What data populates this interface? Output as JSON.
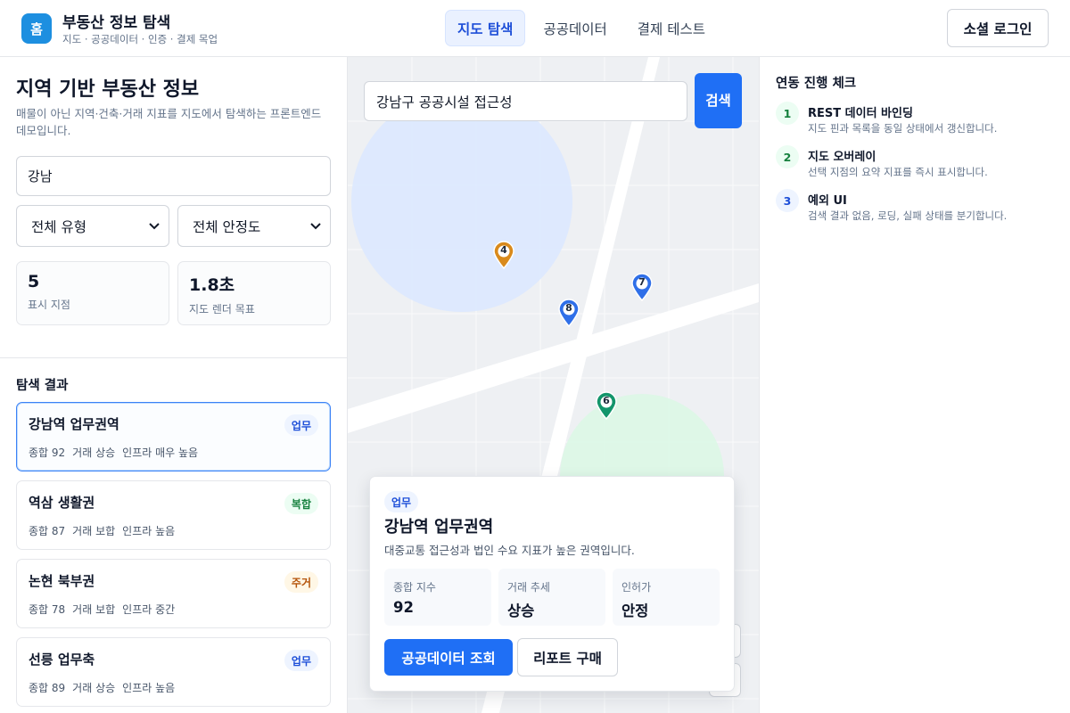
{
  "header": {
    "logo_text": "홈",
    "brand_title": "부동산 정보 탐색",
    "brand_subtitle": "지도 · 공공데이터 · 인증 · 결제 목업",
    "tabs": [
      {
        "label": "지도 탐색",
        "active": true
      },
      {
        "label": "공공데이터",
        "active": false
      },
      {
        "label": "결제 테스트",
        "active": false
      }
    ],
    "login_label": "소셜 로그인"
  },
  "left": {
    "title": "지역 기반 부동산 정보",
    "description": "매물이 아닌 지역·건축·거래 지표를 지도에서 탐색하는 프론트엔드 데모입니다.",
    "search_value": "강남",
    "type_filter": "전체 유형",
    "stability_filter": "전체 안정도",
    "stats": [
      {
        "value": "5",
        "label": "표시 지점"
      },
      {
        "value": "1.8초",
        "label": "지도 렌더 목표"
      }
    ],
    "results_title": "탐색 결과",
    "results": [
      {
        "title": "강남역 업무권역",
        "badge": "업무",
        "score": "종합 92",
        "trade": "거래 상승",
        "infra": "인프라 매우 높음",
        "active": true
      },
      {
        "title": "역삼 생활권",
        "badge": "복합",
        "score": "종합 87",
        "trade": "거래 보합",
        "infra": "인프라 높음",
        "active": false
      },
      {
        "title": "논현 북부권",
        "badge": "주거",
        "score": "종합 78",
        "trade": "거래 보합",
        "infra": "인프라 중간",
        "active": false
      },
      {
        "title": "선릉 업무축",
        "badge": "업무",
        "score": "종합 89",
        "trade": "거래 상승",
        "infra": "인프라 높음",
        "active": false
      }
    ]
  },
  "map": {
    "search_value": "강남구 공공시설 접근성",
    "search_button": "검색",
    "pins": [
      {
        "number": "4",
        "color": "#d98a1c"
      },
      {
        "number": "7",
        "color": "#2f6fe8"
      },
      {
        "number": "8",
        "color": "#2f6fe8"
      },
      {
        "number": "6",
        "color": "#13956b"
      }
    ],
    "popup": {
      "badge": "업무",
      "title": "강남역 업무권역",
      "description": "대중교통 접근성과 법인 수요 지표가 높은 권역입니다.",
      "metrics": [
        {
          "label": "종합 지수",
          "value": "92"
        },
        {
          "label": "거래 추세",
          "value": "상승"
        },
        {
          "label": "인허가",
          "value": "안정"
        }
      ],
      "primary_button": "공공데이터 조회",
      "secondary_button": "리포트 구매"
    }
  },
  "right": {
    "title": "연동 진행 체크",
    "steps": [
      {
        "number": "1",
        "title": "REST 데이터 바인딩",
        "description": "지도 핀과 목록을 동일 상태에서 갱신합니다."
      },
      {
        "number": "2",
        "title": "지도 오버레이",
        "description": "선택 지점의 요약 지표를 즉시 표시합니다."
      },
      {
        "number": "3",
        "title": "예외 UI",
        "description": "검색 결과 없음, 로딩, 실패 상태를 분기합니다."
      }
    ]
  }
}
